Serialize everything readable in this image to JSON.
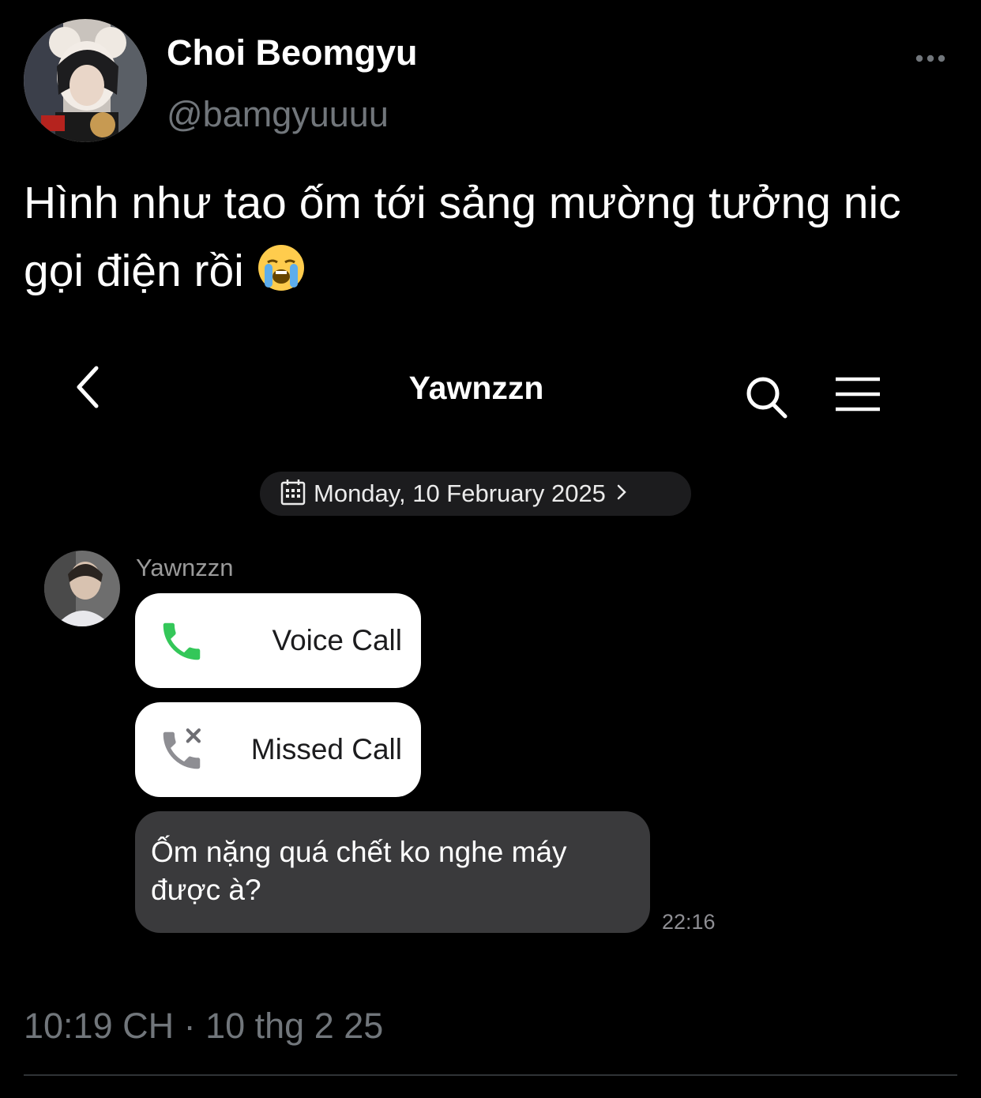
{
  "tweet": {
    "author": {
      "display_name": "Choi Beomgyu",
      "handle": "@bamgyuuuu",
      "avatar_icon": "profile-photo"
    },
    "more_icon": "more-horizontal-icon",
    "text": "Hình như tao ốm tới sảng mường tưởng nic gọi điện rồi",
    "emoji": "loudly-crying-face",
    "timestamp": "10:19 CH · 10 thg 2 25"
  },
  "chat": {
    "header": {
      "title": "Yawnzzn",
      "back_icon": "chevron-left-icon",
      "search_icon": "search-icon",
      "menu_icon": "menu-icon"
    },
    "date_pill": {
      "icon": "calendar-icon",
      "text": "Monday, 10 February 2025",
      "chevron_icon": "chevron-right-icon"
    },
    "sender": {
      "name": "Yawnzzn",
      "avatar_icon": "profile-photo"
    },
    "messages": [
      {
        "type": "call",
        "label": "Voice Call",
        "icon": "phone-icon",
        "icon_color": "#34c759"
      },
      {
        "type": "call",
        "label": "Missed Call",
        "icon": "missed-call-icon",
        "icon_color": "#8e8e93"
      },
      {
        "type": "text",
        "text": "Ốm nặng quá chết ko nghe máy được à?",
        "time": "22:16"
      }
    ]
  },
  "colors": {
    "background": "#000000",
    "muted_text": "#71767b",
    "bubble_dark": "#3a3a3c",
    "bubble_light": "#ffffff"
  }
}
